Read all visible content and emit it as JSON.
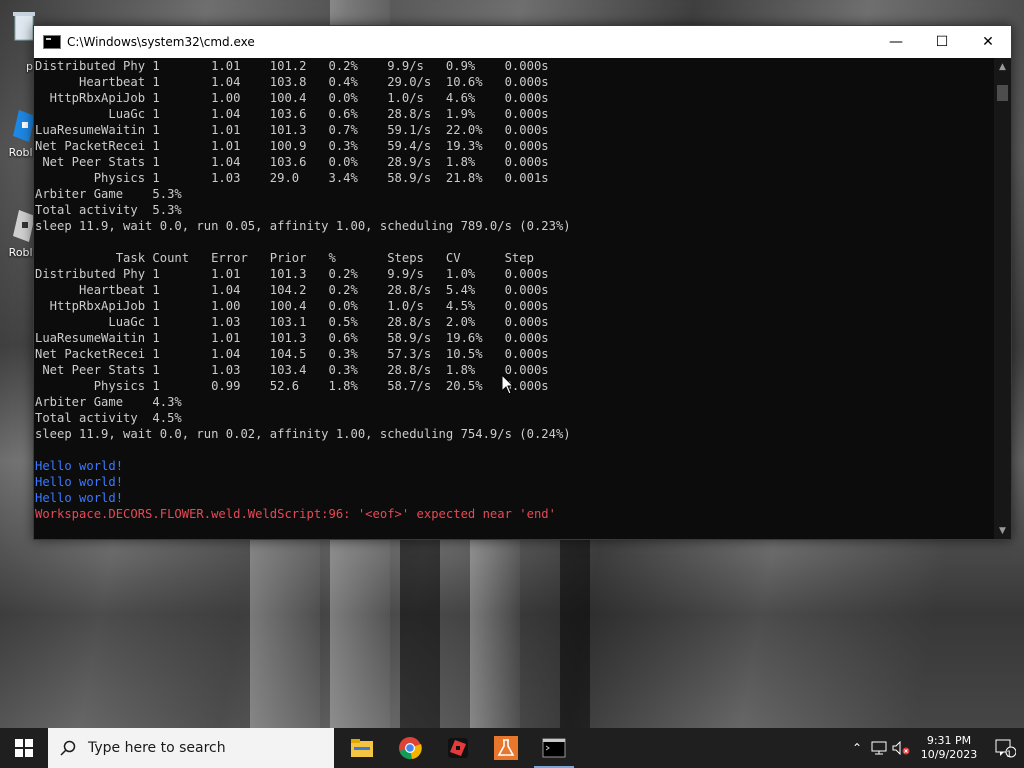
{
  "desktop": {
    "icons": [
      {
        "name": "recycle-bin",
        "label": "p"
      },
      {
        "name": "roblox-player",
        "label": "Roblo"
      },
      {
        "name": "roblox-studio",
        "label": "Roblo"
      }
    ]
  },
  "window": {
    "title": "C:\\Windows\\system32\\cmd.exe",
    "minimize": "—",
    "maximize": "☐",
    "close": "✕"
  },
  "console": {
    "lines": [
      {
        "text": "Distributed Phy 1       1.01    101.2   0.2%    9.9/s   0.9%    0.000s",
        "kind": "normal"
      },
      {
        "text": "      Heartbeat 1       1.04    103.8   0.4%    29.0/s  10.6%   0.000s",
        "kind": "normal"
      },
      {
        "text": "  HttpRbxApiJob 1       1.00    100.4   0.0%    1.0/s   4.6%    0.000s",
        "kind": "normal"
      },
      {
        "text": "          LuaGc 1       1.04    103.6   0.6%    28.8/s  1.9%    0.000s",
        "kind": "normal"
      },
      {
        "text": "LuaResumeWaitin 1       1.01    101.3   0.7%    59.1/s  22.0%   0.000s",
        "kind": "normal"
      },
      {
        "text": "Net PacketRecei 1       1.01    100.9   0.3%    59.4/s  19.3%   0.000s",
        "kind": "normal"
      },
      {
        "text": " Net Peer Stats 1       1.04    103.6   0.0%    28.9/s  1.8%    0.000s",
        "kind": "normal"
      },
      {
        "text": "        Physics 1       1.03    29.0    3.4%    58.9/s  21.8%   0.001s",
        "kind": "normal"
      },
      {
        "text": "Arbiter Game    5.3%",
        "kind": "normal"
      },
      {
        "text": "Total activity  5.3%",
        "kind": "normal"
      },
      {
        "text": "sleep 11.9, wait 0.0, run 0.05, affinity 1.00, scheduling 789.0/s (0.23%)",
        "kind": "normal"
      },
      {
        "text": "",
        "kind": "normal"
      },
      {
        "text": "           Task Count   Error   Prior   %       Steps   CV      Step",
        "kind": "normal"
      },
      {
        "text": "Distributed Phy 1       1.01    101.3   0.2%    9.9/s   1.0%    0.000s",
        "kind": "normal"
      },
      {
        "text": "      Heartbeat 1       1.04    104.2   0.2%    28.8/s  5.4%    0.000s",
        "kind": "normal"
      },
      {
        "text": "  HttpRbxApiJob 1       1.00    100.4   0.0%    1.0/s   4.5%    0.000s",
        "kind": "normal"
      },
      {
        "text": "          LuaGc 1       1.03    103.1   0.5%    28.8/s  2.0%    0.000s",
        "kind": "normal"
      },
      {
        "text": "LuaResumeWaitin 1       1.01    101.3   0.6%    58.9/s  19.6%   0.000s",
        "kind": "normal"
      },
      {
        "text": "Net PacketRecei 1       1.04    104.5   0.3%    57.3/s  10.5%   0.000s",
        "kind": "normal"
      },
      {
        "text": " Net Peer Stats 1       1.03    103.4   0.3%    28.8/s  1.8%    0.000s",
        "kind": "normal"
      },
      {
        "text": "        Physics 1       0.99    52.6    1.8%    58.7/s  20.5%   0.000s",
        "kind": "normal"
      },
      {
        "text": "Arbiter Game    4.3%",
        "kind": "normal"
      },
      {
        "text": "Total activity  4.5%",
        "kind": "normal"
      },
      {
        "text": "sleep 11.9, wait 0.0, run 0.02, affinity 1.00, scheduling 754.9/s (0.24%)",
        "kind": "normal"
      },
      {
        "text": "",
        "kind": "normal"
      },
      {
        "text": "Hello world!",
        "kind": "hello"
      },
      {
        "text": "Hello world!",
        "kind": "hello"
      },
      {
        "text": "Hello world!",
        "kind": "hello"
      },
      {
        "text": "Workspace.DECORS.FLOWER.weld.WeldScript:96: '<eof>' expected near 'end'",
        "kind": "error"
      }
    ]
  },
  "taskbar": {
    "search_placeholder": "Type here to search",
    "apps": [
      {
        "name": "file-explorer-icon",
        "active": false
      },
      {
        "name": "chrome-icon",
        "active": false
      },
      {
        "name": "roblox-studio-icon",
        "active": false
      },
      {
        "name": "lab-flask-icon",
        "active": false
      },
      {
        "name": "cmd-icon",
        "active": true
      }
    ],
    "clock_time": "9:31 PM",
    "clock_date": "10/9/2023",
    "notification_count": "1"
  },
  "colors": {
    "console_bg": "#0c0c0c",
    "console_text": "#cccccc",
    "hello_text": "#3b78ff",
    "error_text": "#e74856",
    "taskbar_bg": "#1f1f1f"
  }
}
